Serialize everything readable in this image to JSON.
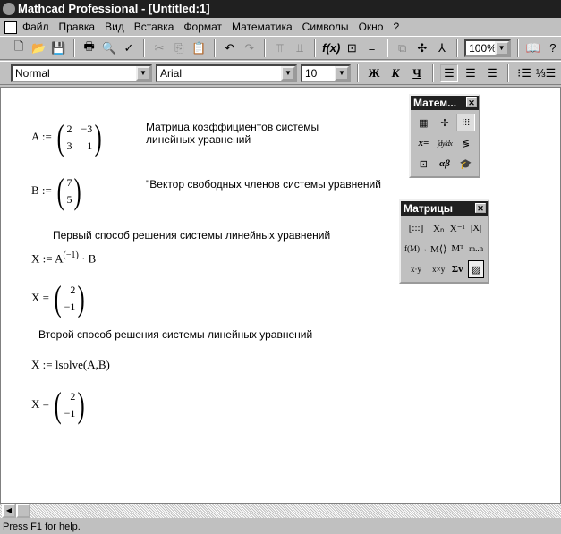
{
  "window": {
    "title": "Mathcad Professional - [Untitled:1]"
  },
  "menu": [
    "Файл",
    "Правка",
    "Вид",
    "Вставка",
    "Формат",
    "Математика",
    "Символы",
    "Окно",
    "?"
  ],
  "toolbar": {
    "zoom": "100%",
    "icons": [
      "new-icon",
      "open-icon",
      "save-icon",
      "print-icon",
      "print-preview-icon",
      "spell-check-icon",
      "cut-icon",
      "copy-icon",
      "paste-icon",
      "undo-icon",
      "redo-icon",
      "align-top-icon",
      "align-down-icon",
      "insert-function-icon",
      "insert-unit-icon",
      "calculate-icon",
      "component-icon",
      "resource-icon",
      "hierarchy-icon",
      "resource-center-icon",
      "help-icon"
    ]
  },
  "format": {
    "style": "Normal",
    "font": "Arial",
    "size": "10",
    "bold": "Ж",
    "italic": "К",
    "underline": "Ч"
  },
  "doc": {
    "a_lhs": "A :=",
    "a_matrix": [
      "2",
      "−3",
      "3",
      "1"
    ],
    "a_comment_1": "Матрица коэффициентов системы",
    "a_comment_2": "линейных уравнений",
    "b_lhs": "B :=",
    "b_matrix": [
      "7",
      "5"
    ],
    "b_comment": "\"Вектор свободных членов системы уравнений",
    "method1": "Первый способ решения системы линейных уравнений",
    "x1_def": "X := A",
    "x1_exp": "(−1)",
    "x1_rest": " · B",
    "x_eq": "X =",
    "x_result": [
      "2",
      "−1"
    ],
    "method2": "Второй способ решения системы линейных уравнений",
    "x2_def": "X := lsolve(A,B)"
  },
  "math_palette": {
    "title": "Матем...",
    "items": [
      "calculator-icon",
      "graph-icon",
      "matrix-icon",
      "x=",
      "∫dy/dx",
      "<≠≥",
      "programming-icon",
      "αβ",
      "symbolic-icon"
    ]
  },
  "matrix_palette": {
    "title": "Матрицы",
    "items": [
      "[:::]",
      "Xₙ",
      "X⁻¹",
      "|X|",
      "f(M)→",
      "M⟨⟩",
      "Mᵀ",
      "m..n",
      "x·y",
      "x×y",
      "Σv",
      "picture-icon"
    ]
  },
  "status": "Press F1 for help."
}
